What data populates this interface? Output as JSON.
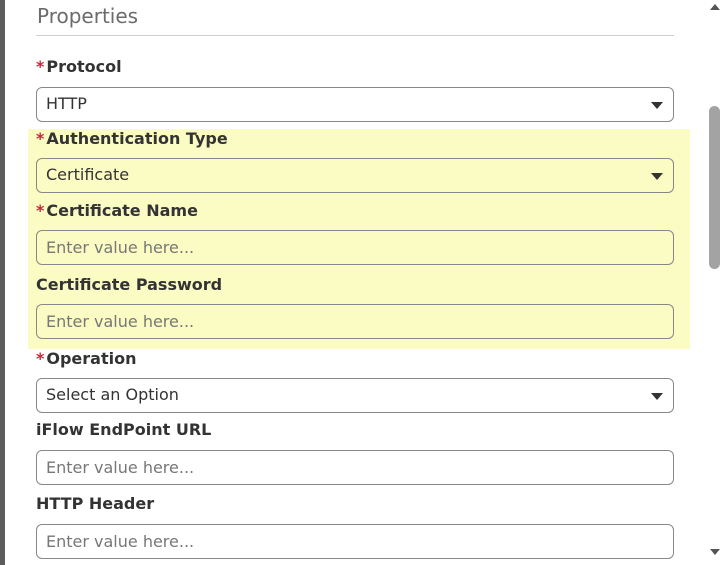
{
  "section": {
    "title": "Properties"
  },
  "fields": {
    "protocol": {
      "required_mark": "*",
      "label": "Protocol",
      "value": "HTTP"
    },
    "auth_type": {
      "required_mark": "*",
      "label": "Authentication Type",
      "value": "Certificate"
    },
    "cert_name": {
      "required_mark": "*",
      "label": "Certificate Name",
      "placeholder": "Enter value here..."
    },
    "cert_password": {
      "label": "Certificate Password",
      "placeholder": "Enter value here..."
    },
    "operation": {
      "required_mark": "*",
      "label": "Operation",
      "value": "Select an Option"
    },
    "iflow_url": {
      "label": "iFlow EndPoint URL",
      "placeholder": "Enter value here..."
    },
    "http_header": {
      "label": "HTTP Header",
      "placeholder": "Enter value here..."
    }
  },
  "icons": {
    "dropdown": "chevron-down-icon",
    "scroll_up": "arrow-up-icon",
    "scroll_down": "arrow-down-icon"
  },
  "colors": {
    "highlight": "#fbfbc4",
    "required": "#c0283b",
    "scroll_thumb": "#a3a3a3"
  }
}
